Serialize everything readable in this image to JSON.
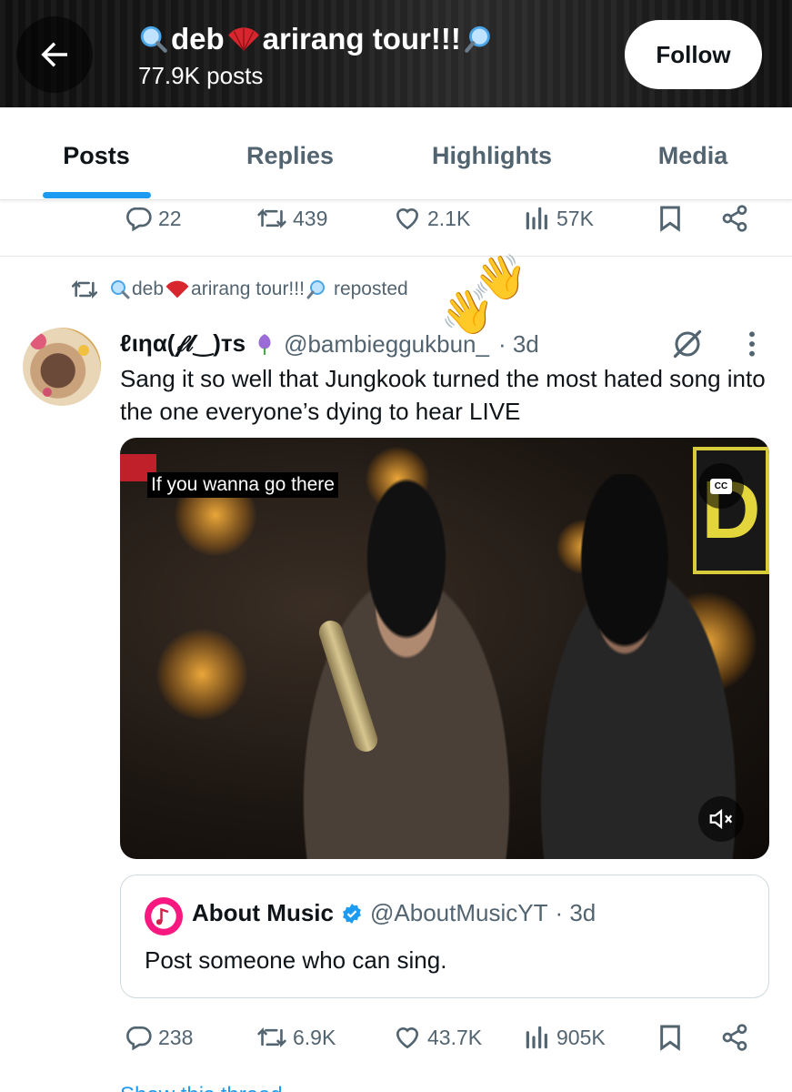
{
  "header": {
    "back_icon": "arrow-left-icon",
    "title_prefix": "deb",
    "title_suffix": "arirang tour!!!",
    "title_icons": [
      "magnifier-icon",
      "folding-fan-icon",
      "magnifier-icon"
    ],
    "post_count": "77.9K posts",
    "follow_label": "Follow"
  },
  "tabs": [
    {
      "label": "Posts",
      "active": true
    },
    {
      "label": "Replies",
      "active": false
    },
    {
      "label": "Highlights",
      "active": false
    },
    {
      "label": "Media",
      "active": false
    }
  ],
  "prev_post_actions": {
    "replies": "22",
    "reposts": "439",
    "likes": "2.1K",
    "views": "57K"
  },
  "repost_banner": {
    "name_prefix": "deb",
    "name_suffix": "arirang tour!!!",
    "suffix": "reposted",
    "sticker": "waving-hands-emoji"
  },
  "post": {
    "display_name": "ℓιηα(𝒻𝓁‿)ᴛs",
    "name_emoji": "purple-tulip-icon",
    "handle": "@bambieggukbun_",
    "time": "· 3d",
    "text": "Sang it so well that Jungkook turned the most hated song into the one everyone’s dying to hear LIVE",
    "media": {
      "caption": "If you wanna go there",
      "cc_label": "CC",
      "stage_sign": "D"
    },
    "quote": {
      "name": "About Music",
      "verified": true,
      "handle": "@AboutMusicYT",
      "time": "· 3d",
      "text": "Post someone who can sing."
    },
    "actions": {
      "replies": "238",
      "reposts": "6.9K",
      "likes": "43.7K",
      "views": "905K"
    }
  },
  "show_thread": "Show this thread",
  "colors": {
    "accent": "#1d9bf0",
    "secondary_text": "#536471",
    "primary_text": "#0f1419"
  }
}
